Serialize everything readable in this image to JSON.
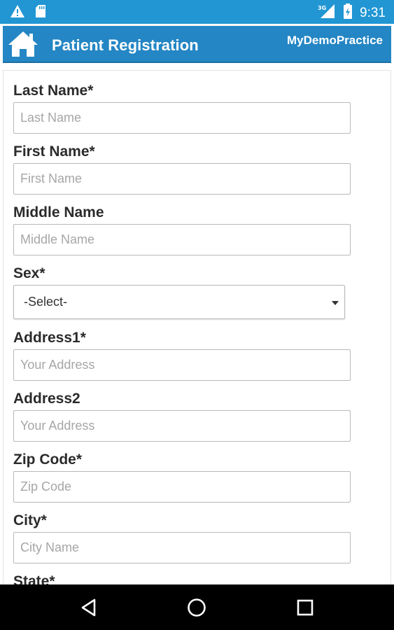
{
  "status_bar": {
    "time": "9:31",
    "icons": [
      "warning-icon",
      "sd-card-icon",
      "signal-3g-icon",
      "battery-icon"
    ],
    "network_label": "3G"
  },
  "header": {
    "title": "Patient Registration",
    "practice": "MyDemoPractice",
    "home_icon": "home-icon"
  },
  "form": {
    "last_name": {
      "label": "Last Name*",
      "placeholder": "Last Name",
      "value": ""
    },
    "first_name": {
      "label": "First Name*",
      "placeholder": "First Name",
      "value": ""
    },
    "middle_name": {
      "label": "Middle Name",
      "placeholder": "Middle Name",
      "value": ""
    },
    "sex": {
      "label": "Sex*",
      "selected": "-Select-"
    },
    "address1": {
      "label": "Address1*",
      "placeholder": "Your Address",
      "value": ""
    },
    "address2": {
      "label": "Address2",
      "placeholder": "Your Address",
      "value": ""
    },
    "zip_code": {
      "label": "Zip Code*",
      "placeholder": "Zip Code",
      "value": ""
    },
    "city": {
      "label": "City*",
      "placeholder": "City Name",
      "value": ""
    },
    "state": {
      "label": "State*"
    }
  },
  "nav": {
    "icons": [
      "back-icon",
      "home-circle-icon",
      "recents-icon"
    ]
  },
  "colors": {
    "status_bar": "#2196d3",
    "header": "#2486c4",
    "nav_bar": "#000000"
  }
}
